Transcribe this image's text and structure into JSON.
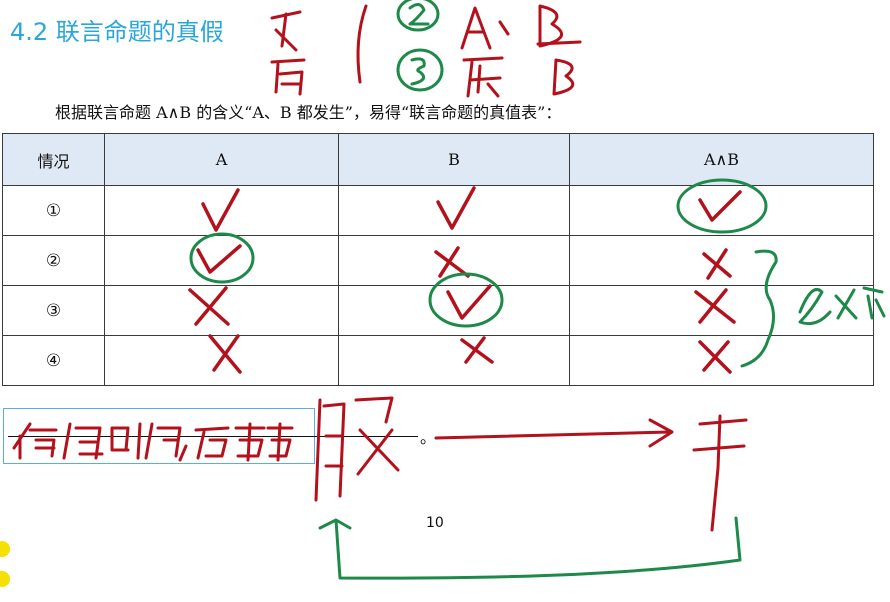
{
  "title": "4.2 联言命题的真假",
  "intro": "根据联言命题 A∧B 的含义“A、B 都发生”，易得“联言命题的真值表”：",
  "table": {
    "headers": [
      "情况",
      "A",
      "B",
      "A∧B"
    ],
    "rows": [
      "①",
      "②",
      "③",
      "④"
    ]
  },
  "blank_period": "。",
  "page_number": "10",
  "colors": {
    "title": "#2aa7d9",
    "ink_red": "#b3121c",
    "ink_green": "#1e8a4a",
    "header_bg": "#dfe9f6"
  }
}
